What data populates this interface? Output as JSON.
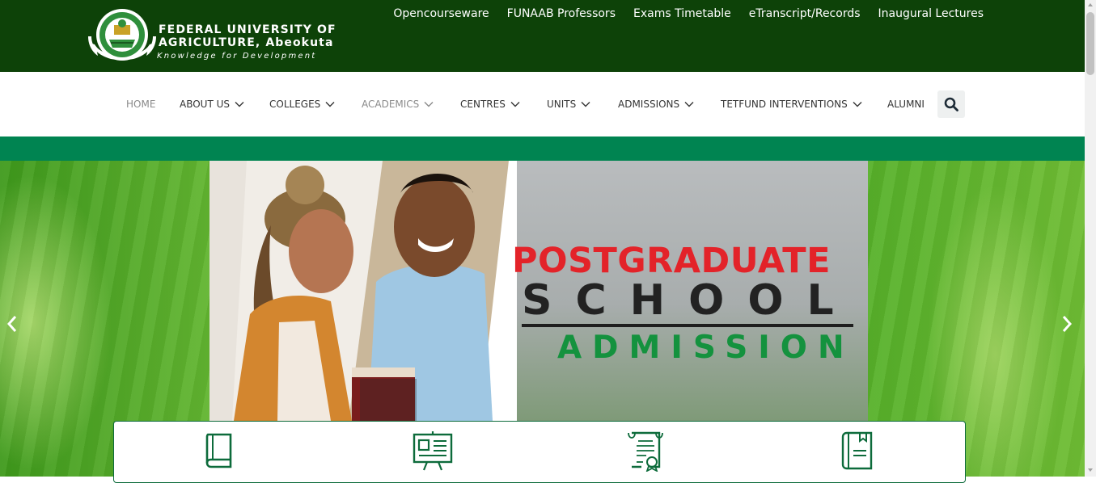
{
  "header": {
    "brand_line1": "FEDERAL UNIVERSITY OF",
    "brand_line2": "AGRICULTURE, Abeokuta",
    "tagline": "Knowledge for Development",
    "top_links": [
      "Opencourseware",
      "FUNAAB Professors",
      "Exams Timetable",
      "eTranscript/Records",
      "Inaugural Lectures"
    ]
  },
  "nav": {
    "items": [
      "HOME",
      "ABOUT US",
      "COLLEGES",
      "ACADEMICS",
      "CENTRES",
      "UNITS",
      "ADMISSIONS",
      "TETFUND INTERVENTIONS",
      "ALUMNI"
    ],
    "search_icon": "search-icon"
  },
  "hero": {
    "line1": "POSTGRADUATE",
    "line2": "SCHOOL",
    "line3": "ADMISSION",
    "prev_icon": "chevron-left-icon",
    "next_icon": "chevron-right-icon"
  },
  "quick_links": {
    "icons": [
      "book-icon",
      "presentation-board-icon",
      "certificate-icon",
      "document-book-icon"
    ]
  },
  "colors": {
    "header_bg": "#0d4208",
    "strip": "#008451",
    "title_red": "#e32329",
    "admission_green": "#14923e",
    "icon_green": "#0d6b3b"
  }
}
